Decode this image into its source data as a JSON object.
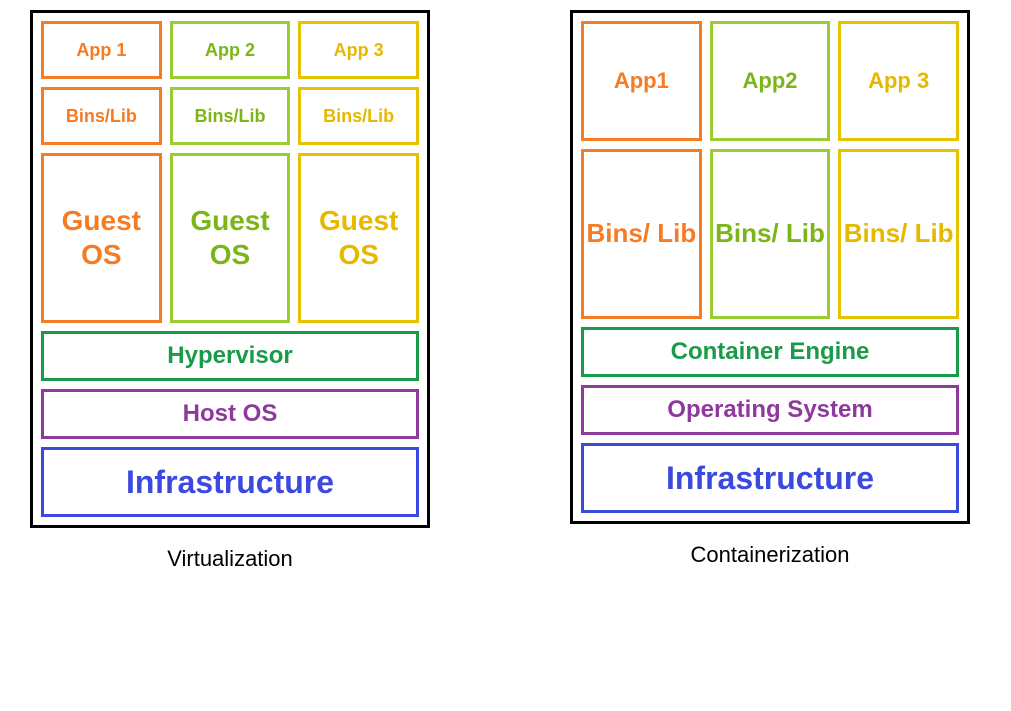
{
  "virtualization": {
    "columns": [
      {
        "app": "App 1",
        "bins": "Bins/Lib",
        "guest": "Guest OS",
        "color": "c-orange"
      },
      {
        "app": "App 2",
        "bins": "Bins/Lib",
        "guest": "Guest OS",
        "color": "c-lime"
      },
      {
        "app": "App 3",
        "bins": "Bins/Lib",
        "guest": "Guest OS",
        "color": "c-yellow"
      }
    ],
    "hypervisor": "Hypervisor",
    "host_os": "Host OS",
    "infrastructure": "Infrastructure",
    "caption": "Virtualization"
  },
  "containerization": {
    "apps": [
      {
        "label": "App1",
        "color": "c-orange"
      },
      {
        "label": "App2",
        "color": "c-lime"
      },
      {
        "label": "App 3",
        "color": "c-yellow"
      }
    ],
    "bins": [
      {
        "label": "Bins/ Lib",
        "color": "c-orange"
      },
      {
        "label": "Bins/ Lib",
        "color": "c-lime"
      },
      {
        "label": "Bins/ Lib",
        "color": "c-yellow"
      }
    ],
    "engine": "Container Engine",
    "os": "Operating System",
    "infrastructure": "Infrastructure",
    "caption": "Containerization"
  },
  "colors": {
    "orange": "#f57c23",
    "lime": "#9acd32",
    "yellow": "#e6c200",
    "green": "#1a9b4a",
    "purple": "#8e3a9d",
    "blue": "#3b49df"
  }
}
